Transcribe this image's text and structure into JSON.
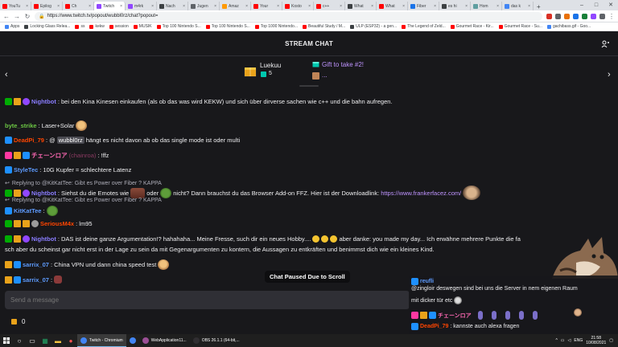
{
  "browser": {
    "tabs": [
      {
        "label": "YouTu",
        "color": "#ff0000"
      },
      {
        "label": "Epilog",
        "color": "#ff0000"
      },
      {
        "label": "Ch",
        "color": "#ff0000"
      },
      {
        "label": "Twitch",
        "color": "#9147ff",
        "active": true
      },
      {
        "label": "m4rk",
        "color": "#9147ff"
      },
      {
        "label": "Nach",
        "color": "#3c4043"
      },
      {
        "label": "Jugen",
        "color": "#5f6368"
      },
      {
        "label": "Amaz",
        "color": "#ff9900"
      },
      {
        "label": "Your",
        "color": "#ff0000"
      },
      {
        "label": "Kosto",
        "color": "#ff0000"
      },
      {
        "label": "c++",
        "color": "#ff0000"
      },
      {
        "label": "What",
        "color": "#3c4043"
      },
      {
        "label": "What",
        "color": "#ff0000"
      },
      {
        "label": "Fiber",
        "color": "#1a73e8"
      },
      {
        "label": "es hi",
        "color": "#3c4043"
      },
      {
        "label": "Hom",
        "color": "#5f9ea0"
      },
      {
        "label": "das k",
        "color": "#4285f4"
      }
    ],
    "new_tab": "+",
    "window_controls": [
      "–",
      "□",
      "✕"
    ],
    "url": "https://www.twitch.tv/popout/wubbl0rz/chat?popout=",
    "bookmarks": [
      {
        "label": "Apps",
        "color": "#4285f4"
      },
      {
        "label": "Locking Glass Relea...",
        "color": "#3c4043"
      },
      {
        "label": "ss",
        "color": "#ff0000"
      },
      {
        "label": "kekw",
        "color": "#ff0000"
      },
      {
        "label": "session",
        "color": "#ff0000"
      },
      {
        "label": "MUSIK",
        "color": "#ff0000"
      },
      {
        "label": "Top 100 Nintendo S...",
        "color": "#ff0000"
      },
      {
        "label": "Top 100 Nintendo S...",
        "color": "#ff0000"
      },
      {
        "label": "Top 1000 Nintendo...",
        "color": "#ff0000"
      },
      {
        "label": "Beautiful Study / M...",
        "color": "#ff0000"
      },
      {
        "label": "ULP (ESP32) - a gen...",
        "color": "#3c4043"
      },
      {
        "label": "The Legend of Zeld...",
        "color": "#ff0000"
      },
      {
        "label": "Gourmet Race - Kir...",
        "color": "#ff0000"
      },
      {
        "label": "Gourmet Race - Su...",
        "color": "#ff0000"
      },
      {
        "label": "gachibass.gif - Goo...",
        "color": "#4285f4"
      }
    ]
  },
  "chat": {
    "title": "STREAM CHAT",
    "banner": {
      "sub_user": "Luekuu",
      "sub_count": "5",
      "gift_take": "Gift to take #2!",
      "gift_take_more": "..."
    },
    "messages": {
      "m1": {
        "name": "Nightbot",
        "name_color": "#8a7dff",
        "text": ": bei den Kina Kinesen einkaufen (als ob das was wird KEKW) und sich über dirverse sachen wie c++ und die bahn aufregen."
      },
      "m2": {
        "name": "byte_strike",
        "name_color": "#6cc644",
        "text": ": Laser+Solar"
      },
      "m3": {
        "name": "DeadPi_79",
        "name_color": "#ff4500",
        "mention": "wubbl0rz",
        "pre": ": @",
        "text": " hängt es nicht davon ab ob das single mode ist oder multi"
      },
      "m4": {
        "name": "チェーンロア",
        "name_color": "#ff69b4",
        "muted": "(chainroa)",
        "text": ": !ffz"
      },
      "m5": {
        "name": "StyleTec",
        "name_color": "#5e9cff",
        "text": ": 10G Kupfer = schlechtere Latenz"
      },
      "m6": {
        "reply": "Replying to @KitKatTee: Gibt es Power over Fiber ? KAPPA",
        "name": "Nightbot",
        "name_color": "#8a7dff",
        "text_a": ": Siehst du die Emotes wie ",
        "text_b": " oder ",
        "text_c": " nicht? Dann brauchst du das Browser Add-on FFZ. Hier ist der Downloadlink: ",
        "link": "https://www.frankerfacez.com/"
      },
      "m7": {
        "reply": "Replying to @KitKatTee: Gibt es Power over Fiber ? KAPPA",
        "name": "KitKatTee",
        "name_color": "#5e9cff",
        "text": ":"
      },
      "m8": {
        "name": "SeriousM4x",
        "name_color": "#ff4500",
        "text": ": lm95"
      },
      "m9": {
        "name": "Nightbot",
        "name_color": "#8a7dff",
        "text_a": ": DAS ist deine ganze Argumentation!? hahahaha... Meine Fresse, such dir ein neues Hobby....",
        "text_b": " aber danke: you made my day... Ich erwähne mehrere Punkte die fa",
        "text_c": "sch aber du scheinst gar nicht erst in der Lage zu sein da mit Gegenargumenten zu kontern, die Aussagen zu entkräften und benimmst dich wie ein kleines Kind."
      },
      "m10": {
        "name": "sarrix_07",
        "name_color": "#5e9cff",
        "text": ": China VPN und dann china speed test"
      },
      "m11": {
        "name": "sarrix_07",
        "name_color": "#5e9cff",
        "text": ":"
      }
    },
    "paused_label": "Chat Paused Due to Scroll",
    "input": {
      "placeholder": "Send a message"
    },
    "points": "0"
  },
  "overlay": {
    "l1_name": "reufli",
    "l1_name_color": "#5e9cff",
    "l1_text": "@zingloir deswegen sind bei uns die Server in nem eigenen Raum",
    "l2_text": "mit dicker tür etc",
    "l3_name": "チェーンロア",
    "l3_name_color": "#ff69b4",
    "l4_name": "DeadPi_79",
    "l4_name_color": "#ff4500",
    "l4_text": ": kannste auch alexa fragen"
  },
  "taskbar": {
    "apps": [
      {
        "label": "Twitch - Chromium",
        "color": "#4285f4",
        "active": true
      },
      {
        "label": "",
        "color": "#4285f4"
      },
      {
        "label": "WebApplication11...",
        "color": "#9b4f96"
      },
      {
        "label": "OBS 26.1.1 (64-bit,...",
        "color": "#302e31"
      }
    ],
    "tray_lang": "ENG",
    "time": "21:58",
    "date": "10/08/2021"
  },
  "colors": {
    "bg": "#18181b",
    "accent": "#9147ff",
    "link": "#bf94ff"
  }
}
